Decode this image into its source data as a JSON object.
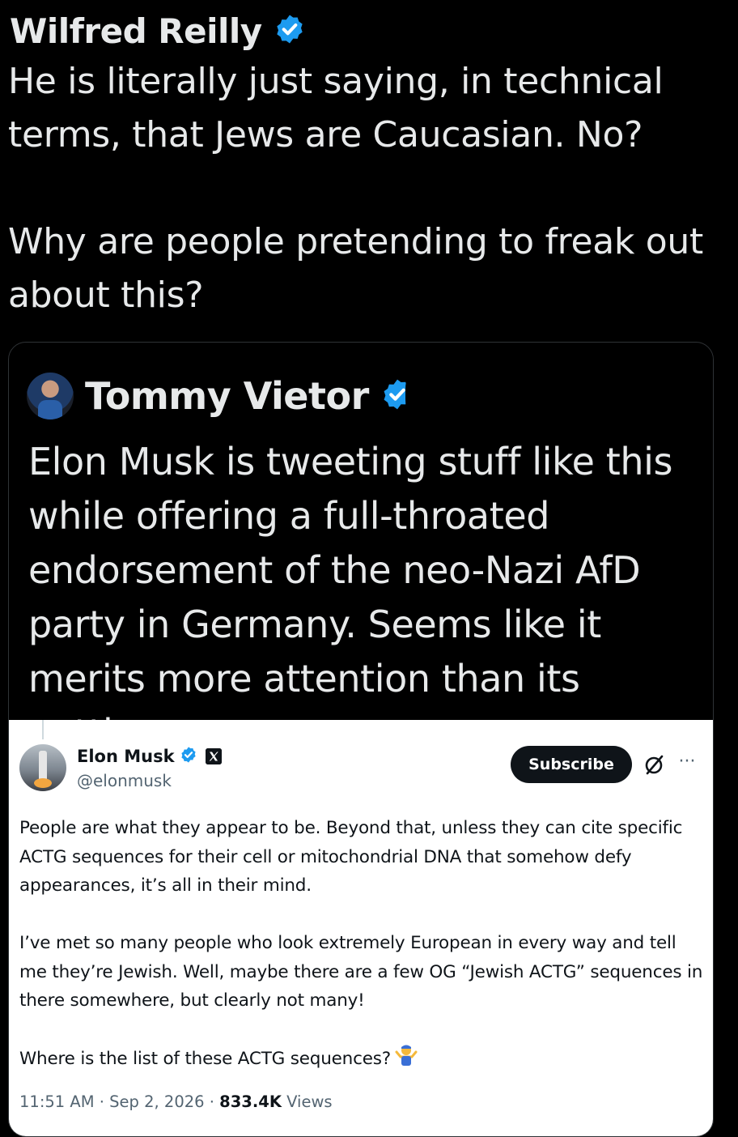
{
  "outer_tweet": {
    "author_name": "Wilfred Reilly",
    "text": "He is literally just saying, in technical terms, that Jews are Caucasian. No?\n\nWhy are people pretending to freak out about this?"
  },
  "quoted_tweet": {
    "author_name": "Tommy Vietor",
    "text": "Elon Musk is tweeting stuff like this while offering a full-throated endorsement of the neo-Nazi AfD party in Germany. Seems like it merits more attention than its getti..."
  },
  "embedded_post": {
    "author_name": "Elon Musk",
    "handle": "@elonmusk",
    "subscribe_label": "Subscribe",
    "more_label": "···",
    "paragraphs": {
      "p1": "People are what they appear to be. Beyond that, unless they can cite specific ACTG sequences for their cell or mitochondrial DNA that somehow defy appearances, it’s all in their mind.",
      "p2": "I’ve met so many people who look extremely European in every way and tell me they’re Jewish. Well, maybe there are a few OG “Jewish ACTG” sequences in there somewhere, but clearly not many!",
      "p3": "Where is the list of these ACTG sequences?"
    },
    "timestamp": "11:51 AM · Sep 2, 2026 · ",
    "views_count": "833.4K",
    "views_label": " Views"
  },
  "icons": {
    "verified": "verified-badge-icon",
    "x_logo": "x-logo-icon",
    "grok": "grok-icon",
    "more": "more-icon",
    "shrug": "person-shrugging-emoji"
  },
  "colors": {
    "background": "#000000",
    "text_primary": "#e7e9ea",
    "verified_blue": "#1d9bf0",
    "card_border": "#2f3336",
    "embed_bg": "#ffffff",
    "embed_text": "#0f1419",
    "embed_secondary": "#536471"
  }
}
